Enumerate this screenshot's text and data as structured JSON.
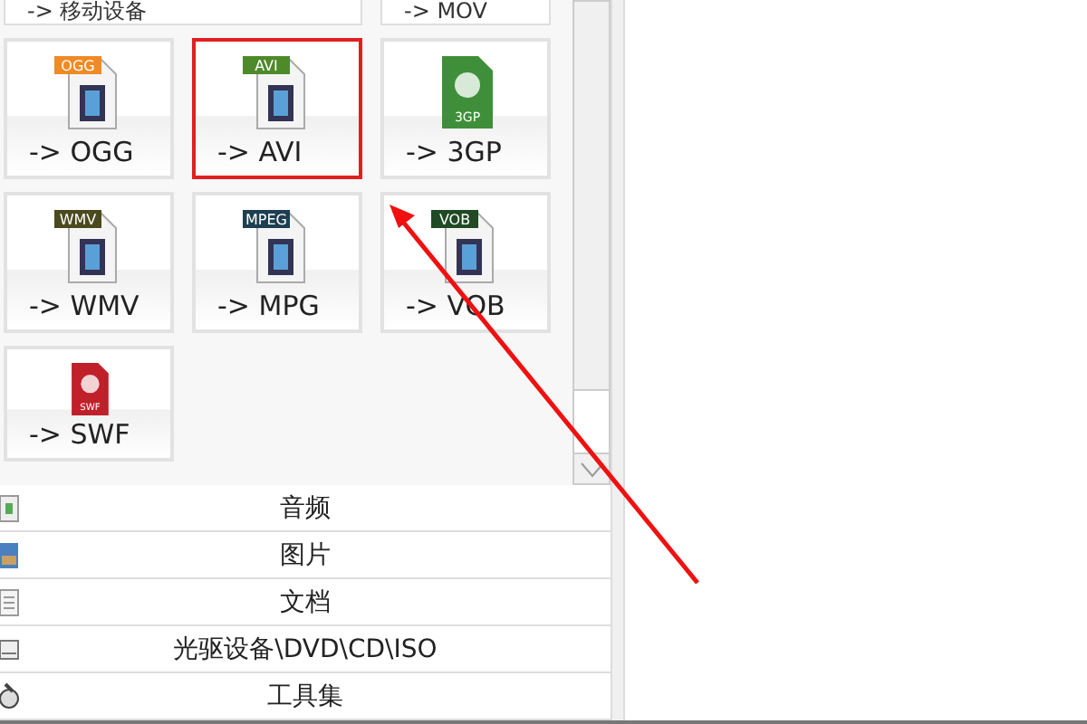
{
  "top_tiles": [
    {
      "label": "-> 移动设备",
      "wide": true
    },
    {
      "label": "-> MOV",
      "wide": false
    }
  ],
  "tiles": [
    {
      "label": "-> OGG",
      "kind": "tagged",
      "tag": "OGG",
      "color": "#f08a24",
      "highlighted": false
    },
    {
      "label": "-> AVI",
      "kind": "tagged",
      "tag": "AVI",
      "color": "#4e8a2a",
      "highlighted": true
    },
    {
      "label": "-> 3GP",
      "kind": "filled",
      "tag": "3GP",
      "color": "#3f8f3a",
      "highlighted": false
    },
    {
      "label": "-> WMV",
      "kind": "tagged",
      "tag": "WMV",
      "color": "#4a4a1e",
      "highlighted": false
    },
    {
      "label": "-> MPG",
      "kind": "tagged",
      "tag": "MPEG",
      "color": "#1e3f52",
      "highlighted": false
    },
    {
      "label": "-> VOB",
      "kind": "tagged",
      "tag": "VOB",
      "color": "#1f4a24",
      "highlighted": false
    },
    {
      "label": "-> SWF",
      "kind": "filled",
      "tag": "SWF",
      "color": "#c0202a",
      "highlighted": false
    }
  ],
  "categories": [
    {
      "label": "音频",
      "kind": "audio"
    },
    {
      "label": "图片",
      "kind": "image"
    },
    {
      "label": "文档",
      "kind": "document"
    },
    {
      "label": "光驱设备\\DVD\\CD\\ISO",
      "kind": "disc"
    },
    {
      "label": "工具集",
      "kind": "tools"
    }
  ]
}
